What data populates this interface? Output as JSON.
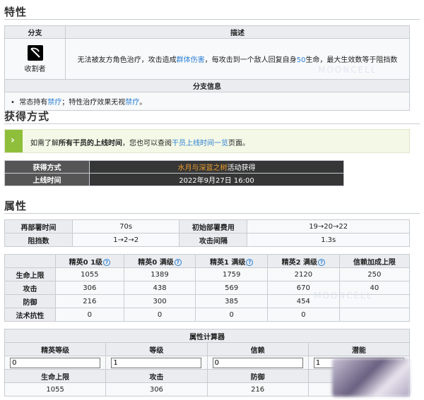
{
  "sections": {
    "trait_title": "特性",
    "obtain_title": "获得方式",
    "attr_title": "属性"
  },
  "trait": {
    "header_branch": "分支",
    "header_desc": "描述",
    "branch_icon": "scythe-icon",
    "branch_name": "收割者",
    "desc_part1": "无法被友方角色治疗，攻击造成",
    "desc_link1": "群体伤害",
    "desc_part2": "，每攻击到一个敌人回复自身",
    "desc_num": "50",
    "desc_part3": "生命，最大生效数等于阻挡数",
    "info_header": "分支信息",
    "info_part1": "常态持有",
    "info_link1": "禁疗",
    "info_part2": "；特性治疗效果无视",
    "info_link2": "禁疗",
    "info_part3": "。"
  },
  "notice": {
    "icon": "chevron-right-icon",
    "part1": "如需了解",
    "bold": "所有干员的上线时间",
    "part2": "，您也可以查阅",
    "link": "干员上线时间一览",
    "part3": "页面。"
  },
  "obtain": {
    "method_label": "获得方式",
    "method_event": "水月与深蓝之树",
    "method_suffix": "活动获得",
    "time_label": "上线时间",
    "time_value": "2022年9月27日 16:00"
  },
  "attr_basic": {
    "redeploy_label": "再部署时间",
    "redeploy_value": "70s",
    "cost_label": "初始部署费用",
    "cost_value": "19→20→22",
    "block_label": "阻挡数",
    "block_value": "1→2→2",
    "interval_label": "攻击间隔",
    "interval_value": "1.3s"
  },
  "attr_stats": {
    "columns": [
      "精英0 1级",
      "精英0 满级",
      "精英1 满级",
      "精英2 满级",
      "信赖加成上限"
    ],
    "rows": [
      {
        "label": "生命上限",
        "values": [
          "1055",
          "1389",
          "1759",
          "2120",
          "250"
        ]
      },
      {
        "label": "攻击",
        "values": [
          "306",
          "438",
          "569",
          "670",
          "40"
        ]
      },
      {
        "label": "防御",
        "values": [
          "216",
          "300",
          "385",
          "454",
          ""
        ]
      },
      {
        "label": "法术抗性",
        "values": [
          "0",
          "0",
          "0",
          "0",
          ""
        ]
      }
    ]
  },
  "calculator": {
    "title": "属性计算器",
    "labels": [
      "精英等级",
      "等级",
      "信赖",
      "潜能"
    ],
    "inputs": [
      "0",
      "1",
      "0",
      "1"
    ],
    "result_labels": [
      "生命上限",
      "攻击",
      "防御"
    ],
    "result_values": [
      "1055",
      "306",
      "216"
    ]
  },
  "watermark": "MOONCELL"
}
